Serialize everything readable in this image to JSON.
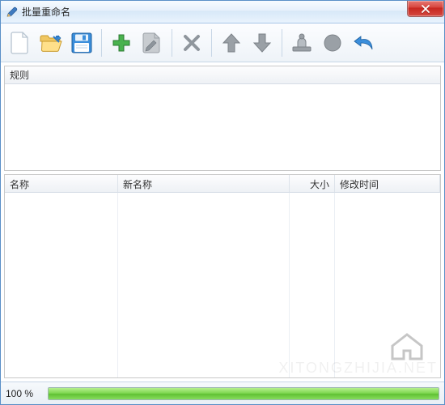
{
  "window": {
    "title": "批量重命名"
  },
  "rules": {
    "header": "规则"
  },
  "columns": {
    "name": "名称",
    "newname": "新名称",
    "size": "大小",
    "mtime": "修改时间"
  },
  "status": {
    "progress_label": "100 %",
    "progress_percent": 100
  },
  "watermark": {
    "text": "XITONGZHIJIA.NET"
  },
  "icons": {
    "app": "pencil-icon",
    "close": "close-icon",
    "new": "file-new-icon",
    "open": "folder-open-icon",
    "save": "floppy-disk-icon",
    "add": "plus-icon",
    "edit": "edit-page-icon",
    "delete": "delete-x-icon",
    "up": "arrow-up-icon",
    "down": "arrow-down-icon",
    "apply": "stamp-icon",
    "run": "circle-icon",
    "undo": "undo-icon"
  }
}
